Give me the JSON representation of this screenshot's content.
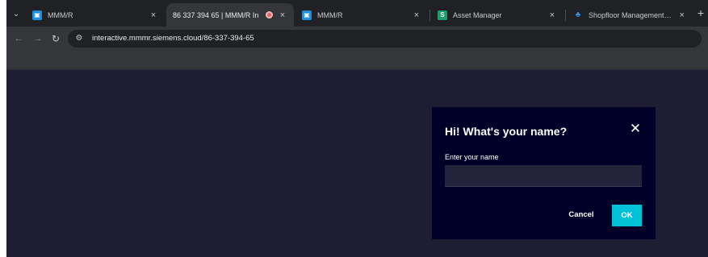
{
  "browser": {
    "tabs": [
      {
        "title": "MMM/R",
        "favicon": "mmm-favicon",
        "favicon_color": "#1f8fdc",
        "active": false
      },
      {
        "title": "86 337 394 65 | MMM/R In",
        "favicon": "none",
        "active": true,
        "recording": true
      },
      {
        "title": "MMM/R",
        "favicon": "mmm-favicon",
        "favicon_color": "#1f8fdc",
        "active": false
      },
      {
        "title": "Asset Manager",
        "favicon": "s-favicon",
        "favicon_letter": "S",
        "favicon_color": "#1a9e6b",
        "active": false
      },
      {
        "title": "Shopfloor Management Applic",
        "favicon": "shopfloor-favicon",
        "favicon_color": "#3c8fd8",
        "active": false
      }
    ],
    "close_glyph": "×",
    "new_tab_glyph": "+",
    "url": "interactive.mmmr.siemens.cloud/86-337-394-65"
  },
  "dialog": {
    "title": "Hi! What's your name?",
    "close_glyph": "✕",
    "field_label": "Enter your name",
    "field_value": "",
    "cancel_label": "Cancel",
    "ok_label": "OK"
  },
  "colors": {
    "content_bg": "#1e1d33",
    "dialog_bg": "#000028",
    "accent": "#00c1d6"
  }
}
